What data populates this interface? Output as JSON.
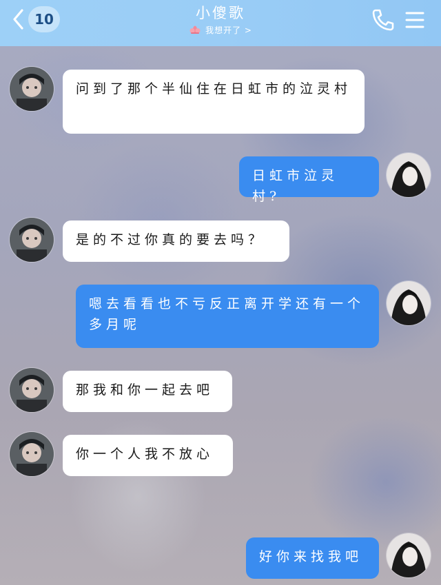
{
  "header": {
    "back_count": "10",
    "contact_name": "小傻歌",
    "status_text": "我想开了 >",
    "status_icon": "lotus-icon",
    "call_icon": "phone-icon",
    "menu_icon": "menu-icon",
    "bar_color": "#9dd0f7"
  },
  "messages": [
    {
      "side": "in",
      "text": "问到了那个半仙住在日虹市的泣灵村"
    },
    {
      "side": "out",
      "text": "日虹市泣灵村?"
    },
    {
      "side": "in",
      "text": "是的不过你真的要去吗？"
    },
    {
      "side": "out",
      "text": "嗯去看看也不亏反正离开学还有一个多月呢"
    },
    {
      "side": "in",
      "text": "那我和你一起去吧"
    },
    {
      "side": "in",
      "text": "你一个人我不放心"
    },
    {
      "side": "out",
      "text": "好你来找我吧"
    }
  ],
  "colors": {
    "incoming_bubble": "#ffffff",
    "outgoing_bubble": "#3a8cf0"
  }
}
